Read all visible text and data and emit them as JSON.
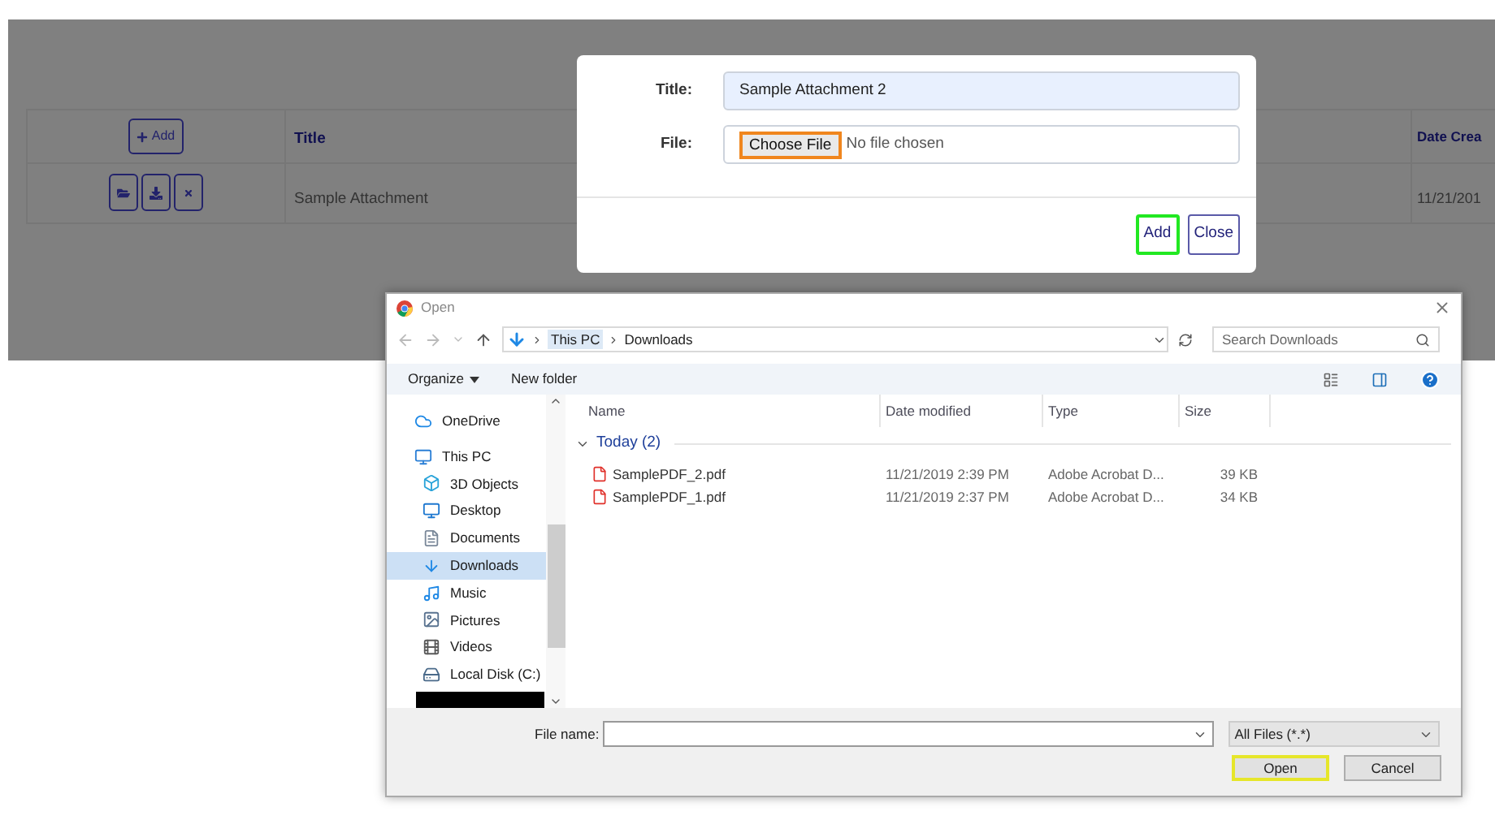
{
  "page": {
    "add_button": "Add",
    "columns": [
      "Title",
      "Date Crea"
    ],
    "rows": [
      {
        "title": "Sample Attachment",
        "date": "11/21/201"
      }
    ]
  },
  "modal": {
    "title_label": "Title:",
    "title_value": "Sample Attachment 2",
    "file_label": "File:",
    "choose_file": {
      "label": "Choose File",
      "highlighted": true
    },
    "file_status": "No file chosen",
    "buttons": [
      {
        "label": "Add",
        "highlighted": true
      },
      {
        "label": "Close",
        "highlighted": false
      }
    ]
  },
  "dialog": {
    "title": "Open",
    "breadcrumb": [
      "This PC",
      "Downloads"
    ],
    "search": {
      "placeholder": "Search Downloads"
    },
    "toolbar": [
      "Organize",
      "New folder"
    ],
    "sidebar": [
      {
        "label": "OneDrive",
        "kind": "cloud",
        "selected": false
      },
      {
        "label": "This PC",
        "kind": "pc",
        "selected": false,
        "children": [
          {
            "label": "3D Objects",
            "kind": "cube",
            "selected": false
          },
          {
            "label": "Desktop",
            "kind": "desktop",
            "selected": false
          },
          {
            "label": "Documents",
            "kind": "documents",
            "selected": false
          },
          {
            "label": "Downloads",
            "kind": "downloads",
            "selected": true
          },
          {
            "label": "Music",
            "kind": "music",
            "selected": false
          },
          {
            "label": "Pictures",
            "kind": "pictures",
            "selected": false
          },
          {
            "label": "Videos",
            "kind": "videos",
            "selected": false
          },
          {
            "label": "Local Disk (C:)",
            "kind": "disk",
            "selected": false
          }
        ]
      }
    ],
    "columns": [
      "Name",
      "Date modified",
      "Type",
      "Size"
    ],
    "group": "Today (2)",
    "files": [
      {
        "name": "SamplePDF_2.pdf",
        "date": "11/21/2019 2:39 PM",
        "type": "Adobe Acrobat D...",
        "size": "39 KB"
      },
      {
        "name": "SamplePDF_1.pdf",
        "date": "11/21/2019 2:37 PM",
        "type": "Adobe Acrobat D...",
        "size": "34 KB"
      }
    ],
    "file_name_label": "File name:",
    "file_type": "All Files (*.*)",
    "buttons": [
      {
        "label": "Open",
        "highlighted": true
      },
      {
        "label": "Cancel",
        "highlighted": false
      }
    ]
  }
}
